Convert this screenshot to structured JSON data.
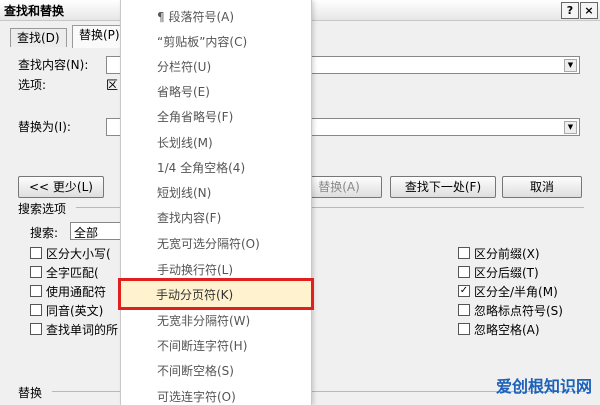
{
  "dialog": {
    "title": "查找和替换",
    "help": "?",
    "close": "×",
    "tabs": [
      "查找(D)",
      "替换(P)"
    ],
    "find_label": "查找内容(N):",
    "options_label": "选项:",
    "options_value": "区",
    "replace_label": "替换为(I):",
    "less_button": "<< 更少(L)",
    "replace_button": "替换(A)",
    "find_next_button": "查找下一处(F)",
    "cancel_button": "取消",
    "search_options_title": "搜索选项",
    "search_label": "搜索:",
    "search_value": "全部",
    "left_checks": [
      {
        "label": "区分大小写(",
        "checked": false
      },
      {
        "label": "全字匹配(",
        "checked": false
      },
      {
        "label": "使用通配符",
        "checked": false
      },
      {
        "label": "同音(英文)",
        "checked": false
      },
      {
        "label": "查找单词的所",
        "checked": false
      }
    ],
    "right_checks": [
      {
        "label": "区分前缀(X)",
        "checked": false
      },
      {
        "label": "区分后缀(T)",
        "checked": false
      },
      {
        "label": "区分全/半角(M)",
        "checked": true
      },
      {
        "label": "忽略标点符号(S)",
        "checked": false
      },
      {
        "label": "忽略空格(A)",
        "checked": false
      }
    ],
    "replace_section": "替换"
  },
  "menu": {
    "items": [
      "¶ 段落符号(A)",
      "“剪贴板”内容(C)",
      "分栏符(U)",
      "省略号(E)",
      "全角省略号(F)",
      "长划线(M)",
      "1/4 全角空格(4)",
      "短划线(N)",
      "查找内容(F)",
      "无宽可选分隔符(O)",
      "手动换行符(L)",
      "手动分页符(K)",
      "无宽非分隔符(W)",
      "不间断连字符(H)",
      "不间断空格(S)",
      "可选连字符(O)"
    ],
    "highlighted": "手动分页符(K)"
  },
  "watermark": "爱创根知识网",
  "colors": {
    "highlight_border": "#e21f1f",
    "highlight_fill": "#fff3cf",
    "watermark": "#1d62b8"
  }
}
